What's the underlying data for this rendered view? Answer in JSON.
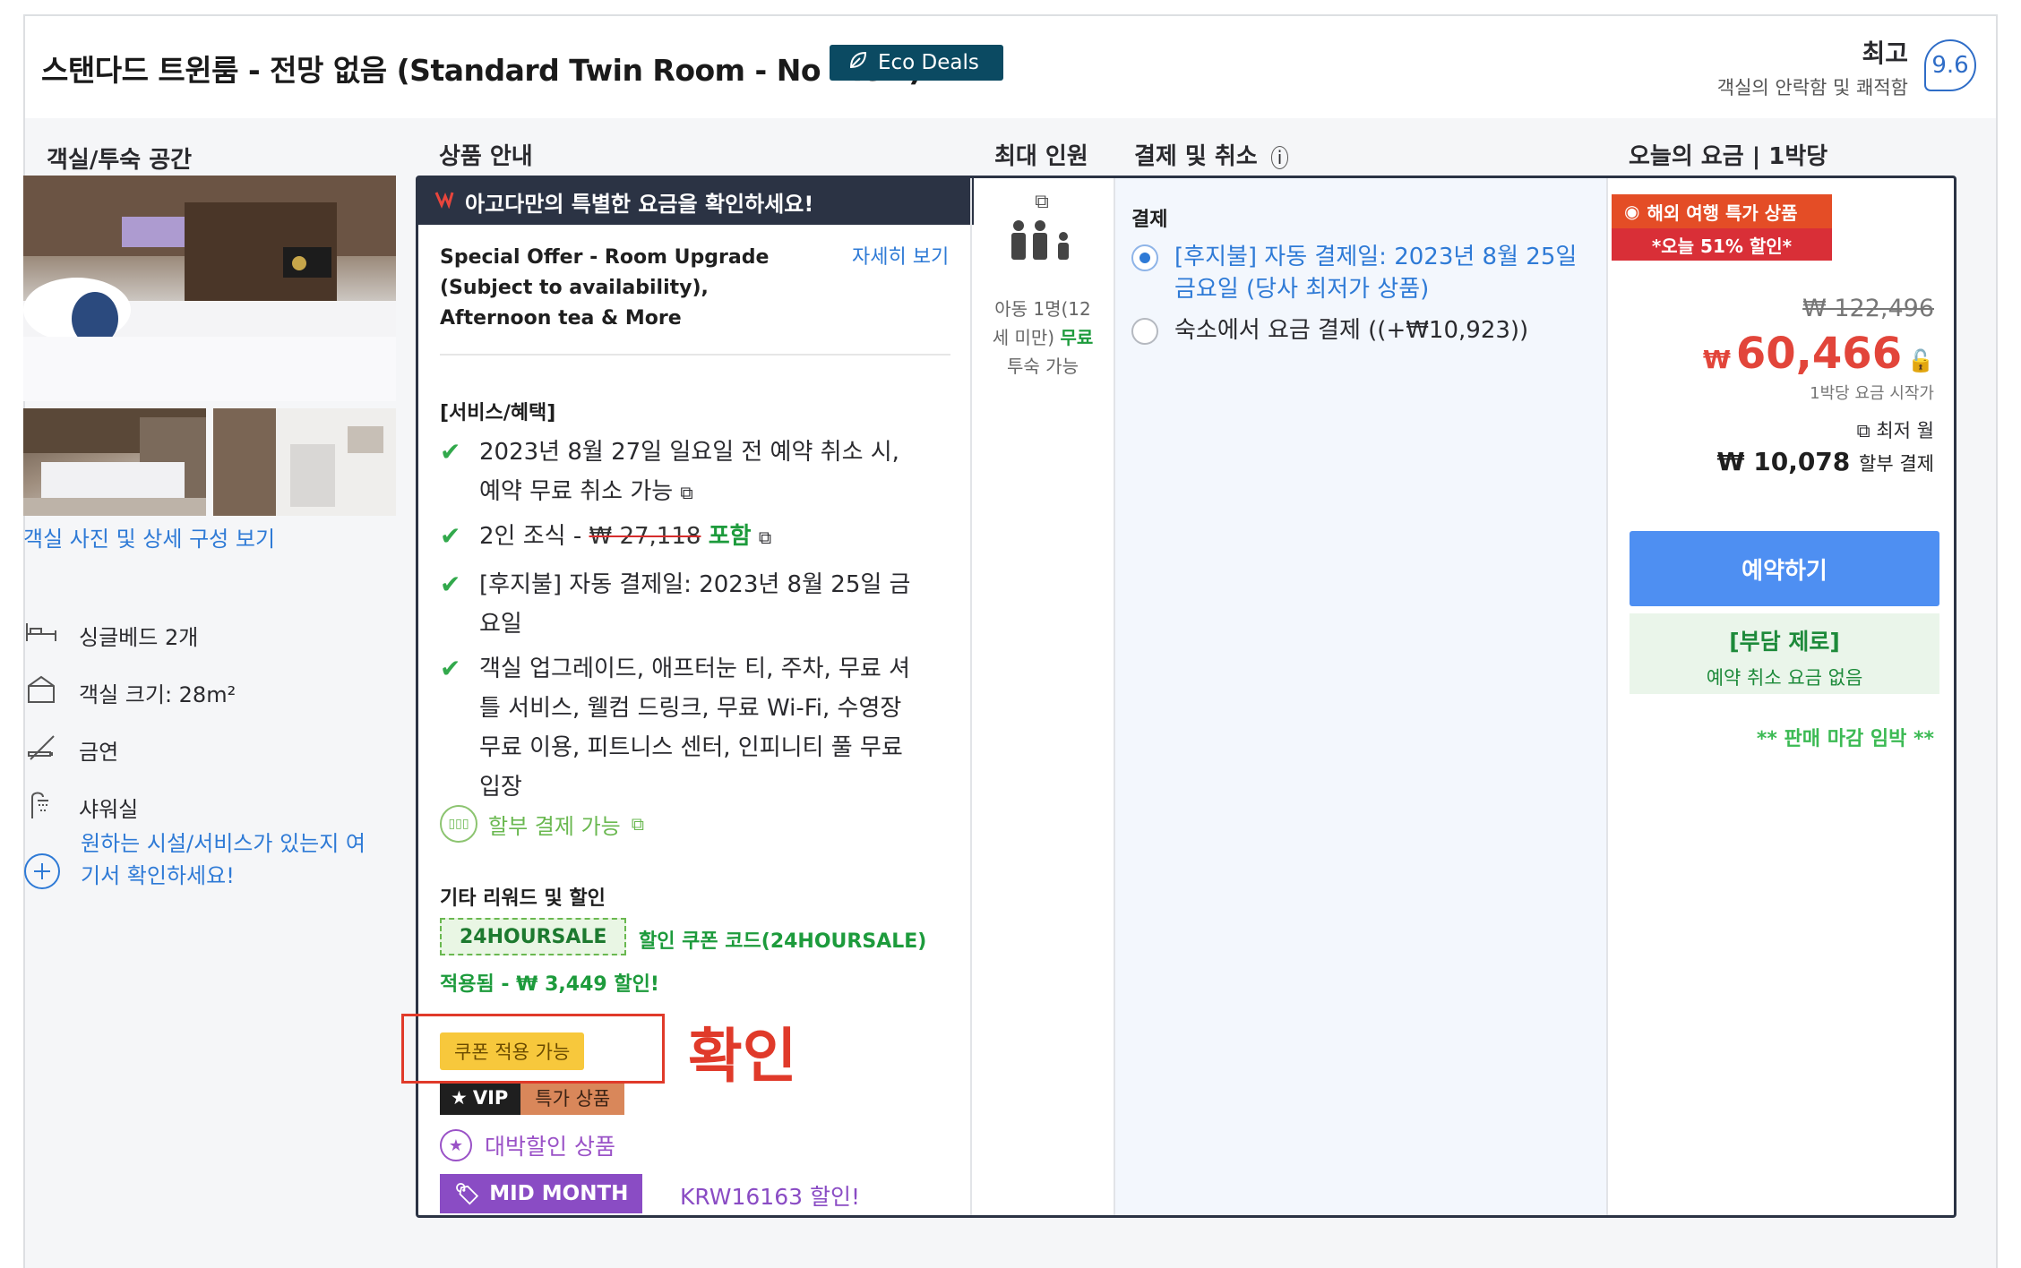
{
  "header": {
    "room_title": "스탠다드 트윈룸 - 전망 없음 (Standard Twin Room - No View)",
    "eco_badge": "Eco Deals",
    "rating_word": "최고",
    "rating_sub": "객실의 안락함 및 쾌적함",
    "score": "9.6"
  },
  "columns": {
    "room": "객실/투숙 공간",
    "product": "상품 안내",
    "occupancy": "최대 인원",
    "payment": "결제 및 취소",
    "price": "오늘의 요금 | 1박당"
  },
  "room": {
    "photos_link": "객실 사진 및 상세 구성 보기",
    "features": [
      {
        "icon": "bed-icon",
        "label": "싱글베드 2개"
      },
      {
        "icon": "room-size-icon",
        "label": "객실 크기: 28m²"
      },
      {
        "icon": "no-smoking-icon",
        "label": "금연"
      },
      {
        "icon": "shower-icon",
        "label": "샤워실"
      }
    ],
    "check_facility": "원하는 시설/서비스가 있는지 여기서 확인하세요!"
  },
  "product": {
    "promo_bar": "아고다만의 특별한 요금을 확인하세요!",
    "offer_title": "Special Offer - Room Upgrade (Subject to availability), Afternoon tea & More",
    "detail_link": "자세히 보기",
    "services_label": "[서비스/혜택]",
    "benefit1": "2023년 8월 27일 일요일 전 예약 취소 시, 예약 무료 취소 가능",
    "benefit2_prefix": "2인 조식 - ",
    "benefit2_strike": "₩ 27,118",
    "benefit2_included": "포함",
    "benefit3": "[후지불] 자동 결제일: 2023년 8월 25일 금요일",
    "benefit4": "객실 업그레이드, 애프터눈 티, 주차, 무료 셔틀 서비스, 웰컴 드링크, 무료 Wi-Fi, 수영장 무료 이용, 피트니스 센터, 인피니티 풀 무료 입장",
    "installment": "할부 결제 가능",
    "rewards_label": "기타 리워드 및 할인",
    "coupon_code": "24HOURSALE",
    "coupon_desc": "할인 쿠폰 코드(24HOURSALE)",
    "applied": "적용됨 - ₩ 3,449 할인!",
    "coupon_available": "쿠폰 적용 가능",
    "confirm_annotation": "확인",
    "vip": "VIP",
    "vip_deal": "특가 상품",
    "jackpot": "대박할인 상품",
    "midmonth": "MID MONTH",
    "krw_discount": "KRW16163 할인!"
  },
  "occupancy": {
    "text_line1": "아동 1명(12",
    "text_line2": "세 미만)",
    "free": "무료",
    "text_line3": "투숙 가능"
  },
  "payment": {
    "title": "결제",
    "option1": "[후지불] 자동 결제일: 2023년 8월 25일 금요일 (당사 최저가 상품)",
    "option2": "숙소에서 요금 결제 ((+₩10,923))"
  },
  "price": {
    "badge1": "해외 여행 특가 상품",
    "badge2": "*오늘 51% 할인*",
    "original": "₩ 122,496",
    "currency": "₩",
    "amount": "60,466",
    "per_night": "1박당 요금 시작가",
    "lowest_label": "최저 월",
    "monthly_amount": "₩ 10,078",
    "monthly_suffix": "할부 결제",
    "book_button": "예약하기",
    "zero_title": "[부담 제로]",
    "zero_sub": "예약 취소 요금 없음",
    "closing_soon": "** 판매 마감 임박 **"
  },
  "colors": {
    "accent_blue": "#2e7ad6",
    "book_button": "#4e8ff2",
    "price_red": "#e2453a",
    "green": "#1d9b3c",
    "annotation_red": "#e03a2a"
  }
}
